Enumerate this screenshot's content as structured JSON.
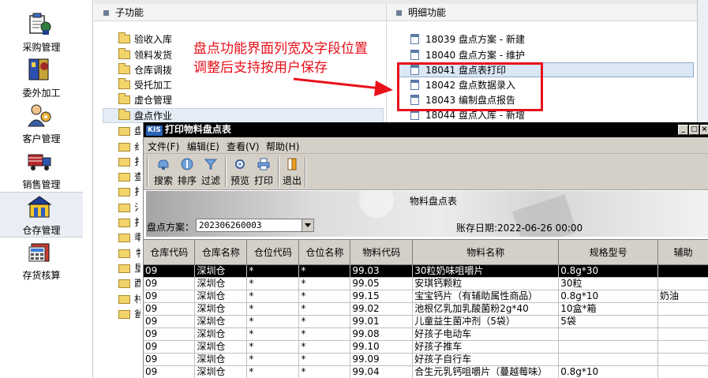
{
  "nav": {
    "items": [
      {
        "label": "采购管理",
        "icon": "purchase-icon"
      },
      {
        "label": "委外加工",
        "icon": "outsourcing-icon"
      },
      {
        "label": "客户管理",
        "icon": "customer-icon"
      },
      {
        "label": "销售管理",
        "icon": "sales-truck-icon"
      },
      {
        "label": "仓存管理",
        "icon": "warehouse-icon"
      },
      {
        "label": "存货核算",
        "icon": "inventory-accounting-icon"
      }
    ],
    "active": "仓存管理"
  },
  "sub_panel": {
    "title": "子功能",
    "items": [
      "验收入库",
      "领料发货",
      "仓库调拨",
      "受托加工",
      "虚仓管理",
      "盘点作业"
    ],
    "selected": "盘点作业",
    "partial_letters": [
      "盘",
      "纟",
      "扌",
      "查",
      "扌",
      "氵",
      "扌",
      "秊",
      "牜",
      "垦",
      "酉",
      "村",
      "瓮"
    ]
  },
  "detail_panel": {
    "title": "明细功能",
    "items": [
      {
        "code": "18039",
        "name": "盘点方案 - 新建"
      },
      {
        "code": "18040",
        "name": "盘点方案 - 维护"
      },
      {
        "code": "18041",
        "name": "盘点表打印"
      },
      {
        "code": "18042",
        "name": "盘点数据录入"
      },
      {
        "code": "18043",
        "name": "编制盘点报告"
      },
      {
        "code": "18044",
        "name": "盘点入库 - 新增"
      }
    ],
    "selected": "18041"
  },
  "annotation": {
    "text_line1": "盘点功能界面列宽及字段位置",
    "text_line2": "调整后支持按用户保存",
    "color": "#e8101a"
  },
  "window": {
    "logo": "KIS",
    "title": "打印物料盘点表",
    "menus": [
      "文件(F)",
      "编辑(E)",
      "查看(V)",
      "帮助(H)"
    ],
    "toolbar": {
      "search": "搜索",
      "sort": "排序",
      "filter": "过滤",
      "preview": "预览",
      "print": "打印",
      "exit": "退出"
    },
    "report_title": "物料盘点表",
    "scheme_label": "盘点方案：",
    "scheme_value": "202306260003",
    "acct_date": "账存日期:2022-06-26 00:00",
    "table": {
      "columns": [
        "仓库代码",
        "仓库名称",
        "仓位代码",
        "仓位名称",
        "物料代码",
        "物料名称",
        "规格型号",
        "辅助"
      ],
      "rows": [
        [
          "09",
          "深圳仓",
          "*",
          "*",
          "99.03",
          "30粒奶味咀嚼片",
          "0.8g*30",
          ""
        ],
        [
          "09",
          "深圳仓",
          "*",
          "*",
          "99.05",
          "安琪钙颗粒",
          "30粒",
          ""
        ],
        [
          "09",
          "深圳仓",
          "*",
          "*",
          "99.15",
          "宝宝钙片（有辅助属性商品）",
          "0.8g*10",
          "奶油"
        ],
        [
          "09",
          "深圳仓",
          "*",
          "*",
          "99.02",
          "池根亿乳加乳酸菌粉2g*40",
          "10盒*箱",
          ""
        ],
        [
          "09",
          "深圳仓",
          "*",
          "*",
          "99.01",
          "儿童益生菌冲剂（5袋）",
          "5袋",
          ""
        ],
        [
          "09",
          "深圳仓",
          "*",
          "*",
          "99.08",
          "好孩子电动车",
          "",
          ""
        ],
        [
          "09",
          "深圳仓",
          "*",
          "*",
          "99.10",
          "好孩子推车",
          "",
          ""
        ],
        [
          "09",
          "深圳仓",
          "*",
          "*",
          "99.09",
          "好孩子自行车",
          "",
          ""
        ],
        [
          "09",
          "深圳仓",
          "*",
          "*",
          "99.04",
          "合生元乳钙咀嚼片（蔓越莓味）",
          "0.8g*10",
          ""
        ]
      ],
      "selected_row": 0
    }
  }
}
